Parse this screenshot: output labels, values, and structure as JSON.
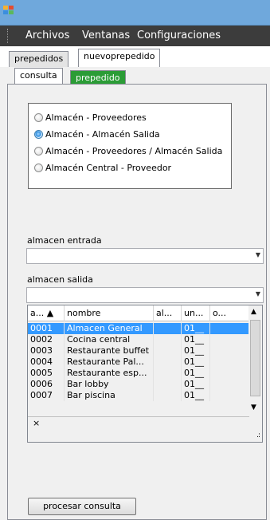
{
  "menu": {
    "items": [
      "Archivos",
      "Ventanas",
      "Configuraciones"
    ]
  },
  "outer_tabs": [
    {
      "label": "prepedidos",
      "active": false
    },
    {
      "label": "nuevoprepedido",
      "active": true
    }
  ],
  "inner_tabs": [
    {
      "label": "consulta",
      "active": true
    },
    {
      "label": "prepedido",
      "active": false
    }
  ],
  "radio_options": [
    {
      "label": "Almacén - Proveedores",
      "checked": false
    },
    {
      "label": "Almacén - Almacén Salida",
      "checked": true
    },
    {
      "label": "Almacén - Proveedores / Almacén Salida",
      "checked": false
    },
    {
      "label": "Almacén Central - Proveedor",
      "checked": false
    }
  ],
  "almacen_entrada": {
    "label": "almacen entrada",
    "value": ""
  },
  "almacen_salida": {
    "label": "almacen salida",
    "value": ""
  },
  "grid": {
    "columns": [
      "a... ▲",
      "nombre",
      "al...",
      "un...",
      "o..."
    ],
    "rows": [
      [
        "0001",
        "Almacen General",
        "",
        "01__",
        ""
      ],
      [
        "0002",
        "Cocina central",
        "",
        "01__",
        ""
      ],
      [
        "0003",
        "Restaurante buffet",
        "",
        "01__",
        ""
      ],
      [
        "0004",
        "Restaurante Pal...",
        "",
        "01__",
        ""
      ],
      [
        "0005",
        "Restaurante esp...",
        "",
        "01__",
        ""
      ],
      [
        "0006",
        "Bar lobby",
        "",
        "01__",
        ""
      ],
      [
        "0007",
        "Bar piscina",
        "",
        "01__",
        ""
      ]
    ],
    "selected_row": 0,
    "new_row_marker": "×"
  },
  "procesar_button": "procesar consulta"
}
